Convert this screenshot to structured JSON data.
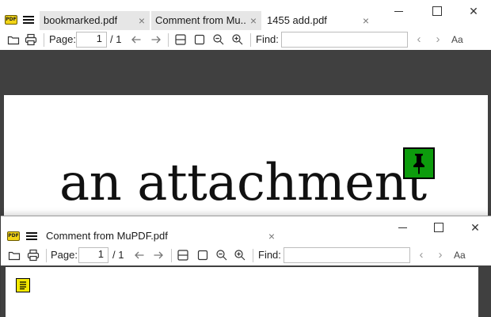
{
  "window_main": {
    "tabs": [
      {
        "label": "bookmarked.pdf",
        "close": "×",
        "active": false
      },
      {
        "label": "Comment  from  Mu...",
        "close": "×",
        "active": false
      },
      {
        "label": "1455 add.pdf",
        "close": "×",
        "active": true
      }
    ],
    "controls": {
      "minimize": "",
      "maximize": "",
      "close": "✕"
    },
    "toolbar": {
      "page_label": "Page:",
      "page_value": "1",
      "page_total": "/ 1",
      "find_label": "Find:",
      "find_value": "",
      "aa_label": "Aa"
    },
    "document": {
      "text": "an attachment",
      "attachment_icon": "pushpin-icon",
      "attachment_color": "#0d9c0d"
    }
  },
  "window_secondary": {
    "title": "Comment from MuPDF.pdf",
    "close": "×",
    "controls": {
      "minimize": "",
      "maximize": "",
      "close": "✕"
    },
    "toolbar": {
      "page_label": "Page:",
      "page_value": "1",
      "page_total": "/ 1",
      "find_label": "Find:",
      "find_value": "",
      "aa_label": "Aa"
    },
    "document": {
      "note_icon": "sticky-note-icon",
      "note_color": "#f2e800"
    }
  },
  "app_icon_text": "PDF",
  "colors": {
    "viewer_bg": "#404040",
    "tab_inactive": "#e6e6e6"
  }
}
